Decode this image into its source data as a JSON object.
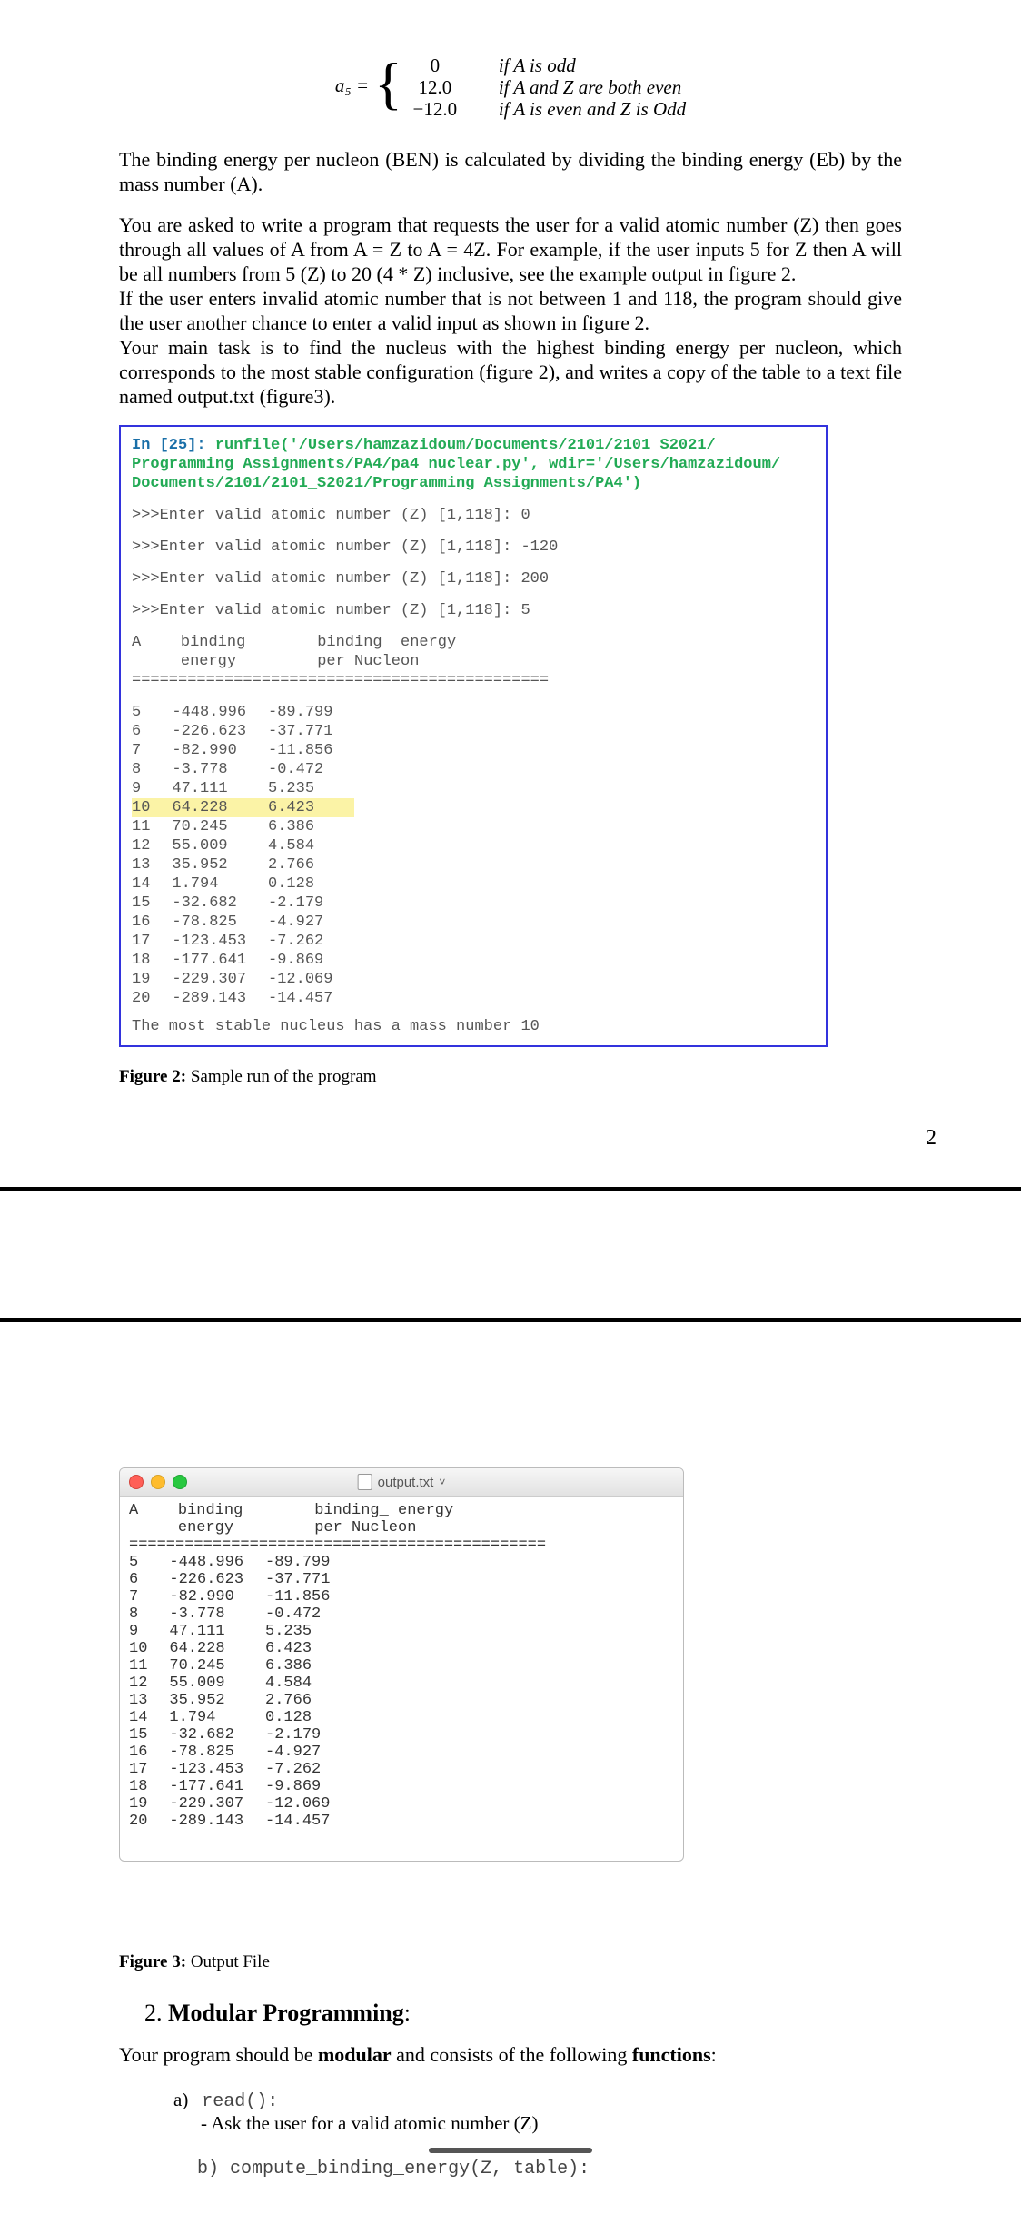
{
  "formula": {
    "lhs": "a₅ =",
    "vals": [
      "0",
      "12.0",
      "−12.0"
    ],
    "conds": [
      "if A is odd",
      "if A and Z are both even",
      "if A is even and Z is Odd"
    ]
  },
  "para1": "The binding energy per nucleon (BEN) is calculated by dividing the binding energy (Eb) by the mass number (A).",
  "para2a": "You are asked to write a program that requests the user for a valid atomic number (Z) then goes through all values of A from A = Z to A = 4Z. For example, if the user inputs 5 for Z then A will be all numbers from 5 (Z) to 20 (4 * Z) inclusive, see the example output in figure 2.",
  "para2b": "If the user enters invalid atomic number that is not between 1 and 118, the program should give the user another chance to enter a valid input as shown in figure 2.",
  "para2c": "Your main task is to find the nucleus with the highest binding energy per nucleon, which corresponds to the most stable configuration (figure 2), and writes a copy of the table to a text file named output.txt (figure3).",
  "console": {
    "in_label": "In [25]:",
    "cmd1": "runfile('/Users/hamzazidoum/Documents/2101/2101_S2021/",
    "cmd2": "Programming Assignments/PA4/pa4_nuclear.py', wdir='/Users/hamzazidoum/",
    "cmd3": "Documents/2101/2101_S2021/Programming Assignments/PA4')",
    "io": [
      ">>>Enter valid atomic number (Z) [1,118]: 0",
      ">>>Enter valid atomic number (Z) [1,118]: -120",
      ">>>Enter valid atomic number (Z) [1,118]: 200",
      ">>>Enter valid atomic number (Z) [1,118]: 5"
    ],
    "head": [
      "A",
      "binding\nenergy",
      "binding_ energy\nper Nucleon"
    ],
    "divider": "=============================================",
    "rows": [
      [
        "5",
        "-448.996",
        "-89.799"
      ],
      [
        "6",
        "-226.623",
        "-37.771"
      ],
      [
        "7",
        "-82.990",
        "-11.856"
      ],
      [
        "8",
        "-3.778",
        "-0.472"
      ],
      [
        "9",
        "47.111",
        "5.235"
      ],
      [
        "10",
        "64.228",
        "6.423"
      ],
      [
        "11",
        "70.245",
        "6.386"
      ],
      [
        "12",
        "55.009",
        "4.584"
      ],
      [
        "13",
        "35.952",
        "2.766"
      ],
      [
        "14",
        "1.794",
        "0.128"
      ],
      [
        "15",
        "-32.682",
        "-2.179"
      ],
      [
        "16",
        "-78.825",
        "-4.927"
      ],
      [
        "17",
        "-123.453",
        "-7.262"
      ],
      [
        "18",
        "-177.641",
        "-9.869"
      ],
      [
        "19",
        "-229.307",
        "-12.069"
      ],
      [
        "20",
        "-289.143",
        "-14.457"
      ]
    ],
    "highlight_index": 5,
    "result": "The most stable nucleus has a mass number 10"
  },
  "fig2_caption_b": "Figure 2:",
  "fig2_caption_t": " Sample run of the program",
  "page_num": "2",
  "mac": {
    "title": "output.txt",
    "chev": "˅"
  },
  "fig3_caption_b": "Figure 3:",
  "fig3_caption_t": " Output File",
  "sec2": {
    "num": "2.",
    "title": "Modular Programming",
    "colon": ":",
    "intro_a": "Your program should be ",
    "intro_b": "modular",
    "intro_c": " and consists of the following ",
    "intro_d": "functions",
    "intro_e": ":",
    "a_label": "a)",
    "a_fn": "read():",
    "a_desc": "- Ask the user for a valid atomic number (Z)",
    "b_label": "b)",
    "b_fn": "compute_binding_energy(Z, table):"
  }
}
